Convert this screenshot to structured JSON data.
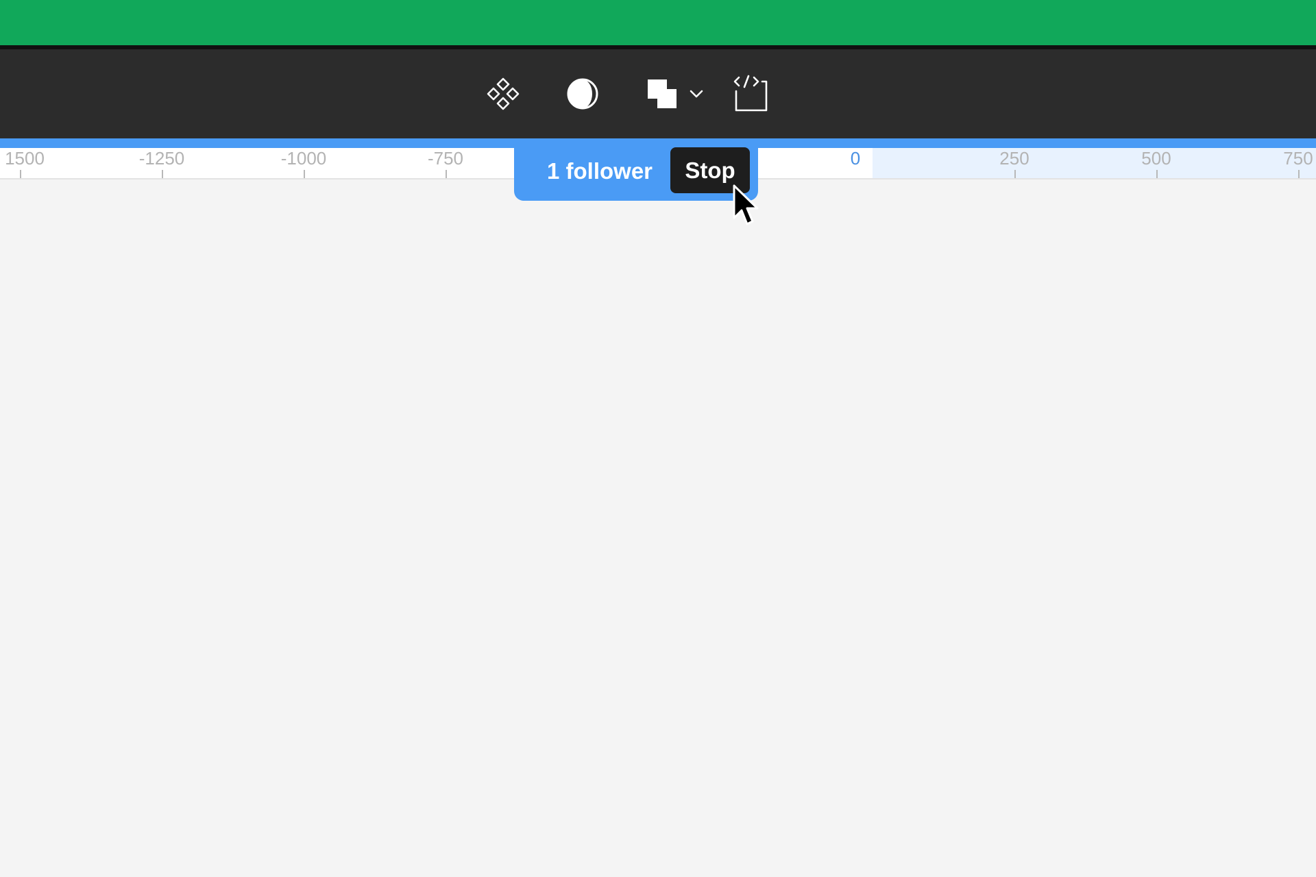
{
  "toolbar": {
    "tools": [
      {
        "name": "components-icon"
      },
      {
        "name": "contrast-icon"
      },
      {
        "name": "boolean-shapes-icon"
      },
      {
        "name": "chevron-down-icon"
      },
      {
        "name": "dev-mode-icon"
      }
    ]
  },
  "ruler": {
    "ticks": [
      "1500",
      "-1250",
      "-1000",
      "-750",
      "0",
      "250",
      "500",
      "750"
    ]
  },
  "spotlight": {
    "follower_label": "1 follower",
    "stop_label": "Stop"
  },
  "colors": {
    "top_strip": "#11a85a",
    "toolbar": "#2c2c2c",
    "spotlight_accent": "#4a9bf5",
    "stop_button": "#1e1e1e",
    "canvas": "#f4f4f4"
  }
}
